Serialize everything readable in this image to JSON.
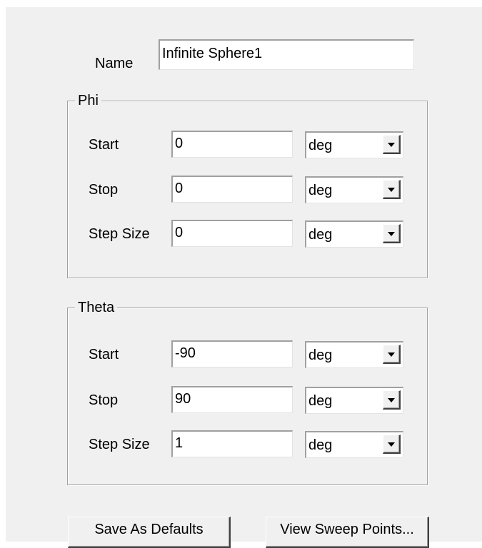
{
  "name": {
    "label": "Name",
    "value": "Infinite Sphere1"
  },
  "phi": {
    "title": "Phi",
    "rows": [
      {
        "label": "Start",
        "value": "0",
        "unit": "deg"
      },
      {
        "label": "Stop",
        "value": "0",
        "unit": "deg"
      },
      {
        "label": "Step Size",
        "value": "0",
        "unit": "deg"
      }
    ]
  },
  "theta": {
    "title": "Theta",
    "rows": [
      {
        "label": "Start",
        "value": "-90",
        "unit": "deg"
      },
      {
        "label": "Stop",
        "value": "90",
        "unit": "deg"
      },
      {
        "label": "Step Size",
        "value": "1",
        "unit": "deg"
      }
    ]
  },
  "buttons": {
    "save_defaults": "Save As Defaults",
    "view_sweep_points": "View Sweep Points..."
  },
  "icons": {
    "dropdown_arrow": "chevron-down-icon"
  }
}
